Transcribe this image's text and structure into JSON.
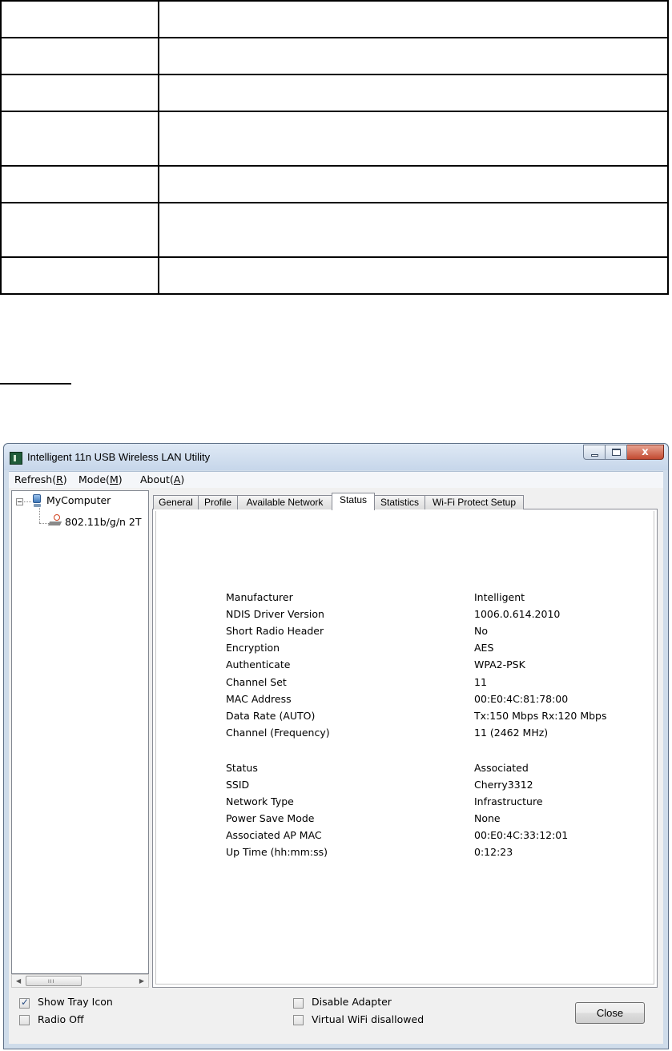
{
  "window": {
    "title": "Intelligent 11n USB Wireless LAN Utility",
    "minimize_icon": "minimize-icon",
    "maximize_icon": "maximize-icon",
    "close_glyph": "x"
  },
  "menu": {
    "items": [
      {
        "label": "Refresh(",
        "accel": "R",
        "tail": ")"
      },
      {
        "label": "Mode(",
        "accel": "M",
        "tail": ")"
      },
      {
        "label": "About(",
        "accel": "A",
        "tail": ")"
      }
    ]
  },
  "tree": {
    "root": "MyComputer",
    "adapter": "802.11b/g/n 2T"
  },
  "tabs": [
    "General",
    "Profile",
    "Available Network",
    "Status",
    "Statistics",
    "Wi-Fi Protect Setup"
  ],
  "active_tab": "Status",
  "status": {
    "group1": [
      {
        "label": "Manufacturer",
        "value": "Intelligent"
      },
      {
        "label": "NDIS Driver Version",
        "value": "1006.0.614.2010"
      },
      {
        "label": "Short Radio Header",
        "value": "No"
      },
      {
        "label": "Encryption",
        "value": "AES"
      },
      {
        "label": "Authenticate",
        "value": "WPA2-PSK"
      },
      {
        "label": "Channel Set",
        "value": "11"
      },
      {
        "label": "MAC Address",
        "value": "00:E0:4C:81:78:00"
      },
      {
        "label": "Data Rate (AUTO)",
        "value": "Tx:150 Mbps Rx:120 Mbps"
      },
      {
        "label": "Channel (Frequency)",
        "value": "11 (2462 MHz)"
      }
    ],
    "group2": [
      {
        "label": "Status",
        "value": "Associated"
      },
      {
        "label": "SSID",
        "value": "Cherry3312"
      },
      {
        "label": "Network Type",
        "value": "Infrastructure"
      },
      {
        "label": "Power Save Mode",
        "value": "None"
      },
      {
        "label": "Associated AP MAC",
        "value": "00:E0:4C:33:12:01"
      },
      {
        "label": "Up Time (hh:mm:ss)",
        "value": "0:12:23"
      }
    ]
  },
  "bottom": {
    "show_tray_icon": {
      "label": "Show Tray Icon",
      "checked": true
    },
    "radio_off": {
      "label": "Radio Off",
      "checked": false
    },
    "disable_adapter": {
      "label": "Disable Adapter",
      "checked": false
    },
    "virtual_wifi": {
      "label": "Virtual WiFi disallowed",
      "checked": false
    },
    "close_button": "Close"
  },
  "scrollbar": {
    "left_arrow": "◀",
    "right_arrow": "▶",
    "grip": "III"
  },
  "colors": {
    "titlebar": "#c6d6ea",
    "close_button": "#c24a31",
    "panel": "#f0f0f0"
  }
}
